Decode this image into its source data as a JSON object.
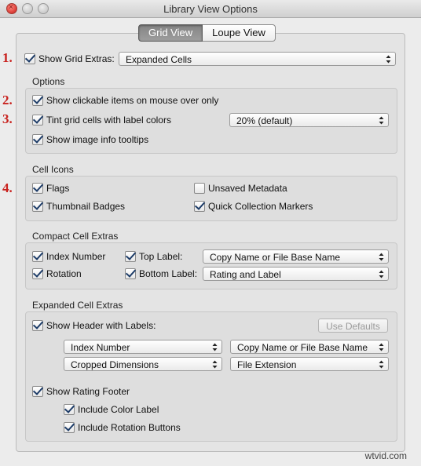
{
  "window": {
    "title": "Library View Options"
  },
  "tabs": [
    {
      "label": "Grid View",
      "active": true
    },
    {
      "label": "Loupe View",
      "active": false
    }
  ],
  "markers": [
    "1.",
    "2.",
    "3.",
    "4."
  ],
  "grid_extras": {
    "label": "Show Grid Extras:",
    "checked": true,
    "value": "Expanded Cells"
  },
  "options": {
    "title": "Options",
    "show_clickable": {
      "label": "Show clickable items on mouse over only",
      "checked": true
    },
    "tint_cells": {
      "label": "Tint grid cells with label colors",
      "checked": true,
      "value": "20% (default)"
    },
    "tooltips": {
      "label": "Show image info tooltips",
      "checked": true
    }
  },
  "cell_icons": {
    "title": "Cell Icons",
    "flags": {
      "label": "Flags",
      "checked": true
    },
    "unsaved_metadata": {
      "label": "Unsaved Metadata",
      "checked": false
    },
    "thumbnail_badges": {
      "label": "Thumbnail Badges",
      "checked": true
    },
    "quick_collection": {
      "label": "Quick Collection Markers",
      "checked": true
    }
  },
  "compact": {
    "title": "Compact Cell Extras",
    "index_number": {
      "label": "Index Number",
      "checked": true
    },
    "rotation": {
      "label": "Rotation",
      "checked": true
    },
    "top_label": {
      "label": "Top Label:",
      "checked": true,
      "value": "Copy Name or File Base Name"
    },
    "bottom_label": {
      "label": "Bottom Label:",
      "checked": true,
      "value": "Rating and Label"
    }
  },
  "expanded": {
    "title": "Expanded Cell Extras",
    "show_header": {
      "label": "Show Header with Labels:",
      "checked": true
    },
    "use_defaults": "Use Defaults",
    "header_selects": [
      "Index Number",
      "Copy Name or File Base Name",
      "Cropped Dimensions",
      "File Extension"
    ],
    "rating_footer": {
      "label": "Show Rating Footer",
      "checked": true
    },
    "color_label": {
      "label": "Include Color Label",
      "checked": true
    },
    "rotation_buttons": {
      "label": "Include Rotation Buttons",
      "checked": true
    }
  },
  "watermark": "wtvid.com",
  "colors": {
    "accent_marker": "#c8211d",
    "check": "#1d3c68"
  },
  "icons": [
    "close-icon",
    "minimize-icon",
    "zoom-icon",
    "checkmark-icon",
    "popup-chevron-icon"
  ]
}
